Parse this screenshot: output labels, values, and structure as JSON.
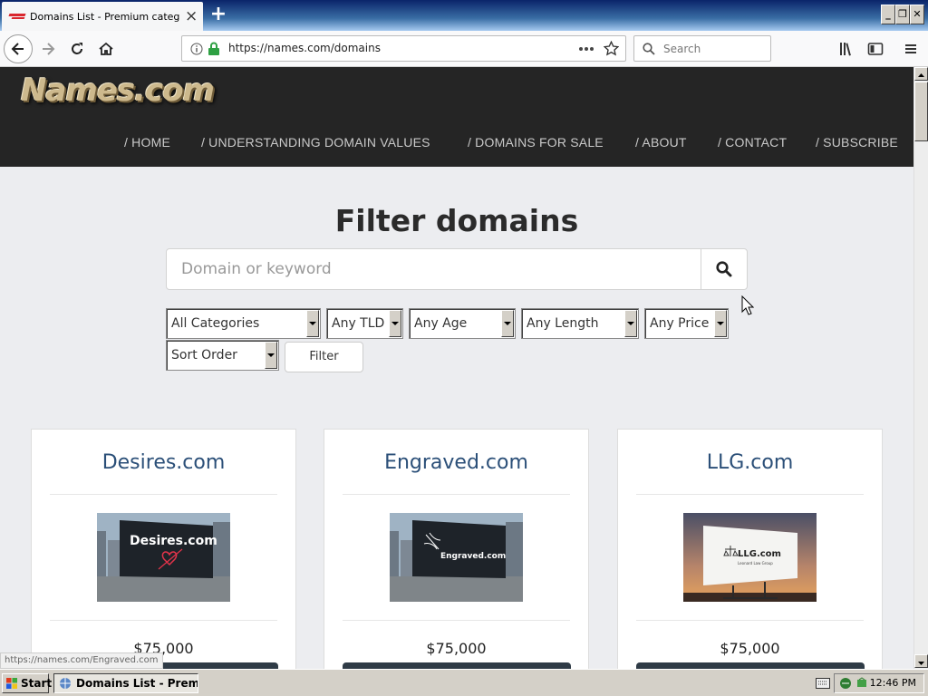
{
  "browser": {
    "tab_title": "Domains List - Premium category d",
    "url": "https://names.com/domains",
    "search_placeholder": "Search",
    "new_tab_symbol": "+",
    "close_symbol": "×"
  },
  "site": {
    "logo": "Names.com",
    "nav": [
      "/ HOME",
      "/ UNDERSTANDING DOMAIN VALUES",
      "/ DOMAINS FOR SALE",
      "/ ABOUT",
      "/ CONTACT",
      "/ SUBSCRIBE"
    ]
  },
  "filter": {
    "title": "Filter domains",
    "keyword_placeholder": "Domain or keyword",
    "selects": {
      "category": "All Categories",
      "tld": "Any TLD",
      "age": "Any Age",
      "length": "Any Length",
      "price": "Any Price",
      "sort": "Sort Order"
    },
    "filter_button": "Filter"
  },
  "cards": [
    {
      "name": "Desires.com",
      "price": "$75,000",
      "billboard_text": "Desires.com"
    },
    {
      "name": "Engraved.com",
      "price": "$75,000",
      "billboard_text": "Engraved.com"
    },
    {
      "name": "LLG.com",
      "price": "$75,000",
      "billboard_text": "LLG.com",
      "billboard_subtext": "Leonard Law Group"
    }
  ],
  "status_bar_url": "https://names.com/Engraved.com",
  "taskbar": {
    "start": "Start",
    "task": "Domains List - Premiu...",
    "clock": "12:46 PM"
  },
  "colors": {
    "header_bg": "#252525",
    "card_title": "#2b4f78",
    "card_button": "#2f3b46",
    "logo_gold": "#cdb98d"
  }
}
